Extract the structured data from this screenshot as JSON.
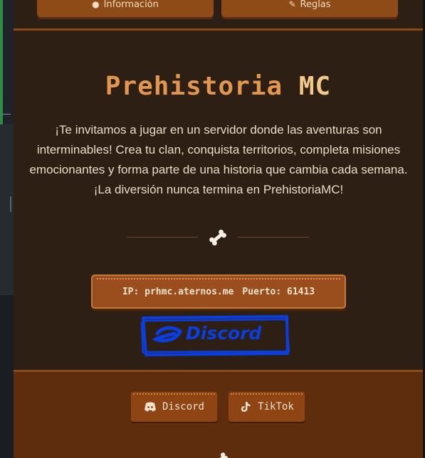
{
  "nav": {
    "left_button": {
      "label": "Información",
      "icon": "info-icon"
    },
    "right_button": {
      "label": "Reglas",
      "icon": "hammer-icon"
    }
  },
  "hero": {
    "title_part1": "Prehistoria",
    "title_part2": "MC",
    "description": "¡Te invitamos a jugar en un servidor donde las aventuras son interminables! Crea tu clan, conquista territorios, completa misiones emocionantes y forma parte de una historia que cambia cada semana. ¡La diversión nunca termina en PrehistoriaMC!",
    "divider_icon": "bone-icon"
  },
  "server": {
    "ip_text": "IP: prhmc.aternos.me",
    "port_text": "Puerto: 61413"
  },
  "handwritten_discord": {
    "text": "Discord",
    "color": "#0a3ee0"
  },
  "footer": {
    "buttons": [
      {
        "label": "Discord",
        "icon": "discord-icon"
      },
      {
        "label": "TikTok",
        "icon": "tiktok-icon"
      }
    ],
    "divider_icon": "bone-icon"
  },
  "colors": {
    "background": "#2e1f14",
    "accent_orange": "#e3974e",
    "accent_light": "#f2c98a",
    "button_brown": "#9a4e1d",
    "footer_brown": "#5e2d0d"
  }
}
